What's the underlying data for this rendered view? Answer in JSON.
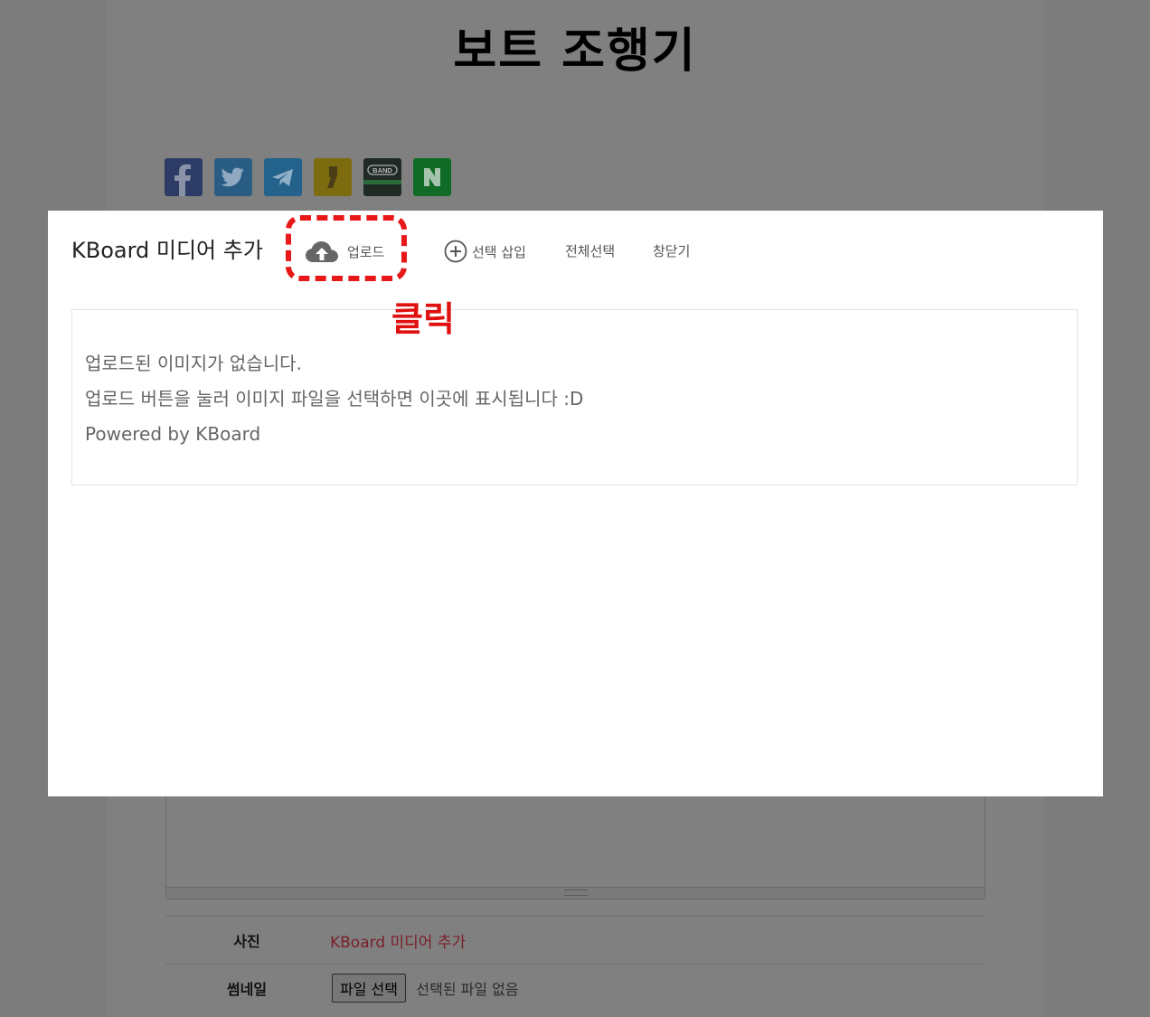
{
  "page": {
    "title": "보트 조행기"
  },
  "share": [
    {
      "name": "facebook",
      "icon": "facebook-icon",
      "color": "#2c3c66"
    },
    {
      "name": "twitter",
      "icon": "twitter-icon",
      "color": "#2a5d84"
    },
    {
      "name": "telegram",
      "icon": "telegram-icon",
      "color": "#23628a"
    },
    {
      "name": "kakaostory",
      "icon": "kakaostory-icon",
      "color": "#7d6b10"
    },
    {
      "name": "band",
      "icon": "band-icon",
      "color": "#1f2a24",
      "label": "BAND"
    },
    {
      "name": "naver",
      "icon": "naver-icon",
      "color": "#0f6b25"
    }
  ],
  "modal": {
    "title": "KBoard 미디어 추가",
    "toolbar": {
      "upload": "업로드",
      "insert_selected": "선택 삽입",
      "select_all": "전체선택",
      "close": "창닫기"
    },
    "empty_lines": [
      "업로드된 이미지가 없습니다.",
      "업로드 버튼을 눌러 이미지 파일을 선택하면 이곳에 표시됩니다 :D",
      "Powered by KBoard"
    ]
  },
  "annotation": {
    "click_label": "클릭",
    "color": "#e81818"
  },
  "form": {
    "photo_label": "사진",
    "photo_link": "KBoard 미디어 추가",
    "thumbnail_label": "썸네일",
    "file_button": "파일 선택",
    "file_status": "선택된 파일 없음"
  }
}
